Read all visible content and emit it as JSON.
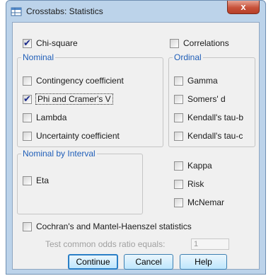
{
  "window": {
    "title": "Crosstabs: Statistics",
    "close_label": "x"
  },
  "chi_square": {
    "label": "Chi-square",
    "checked": true
  },
  "correlations": {
    "label": "Correlations",
    "checked": false
  },
  "nominal": {
    "legend": "Nominal",
    "items": [
      {
        "label": "Contingency coefficient",
        "checked": false
      },
      {
        "label": "Phi and Cramer's V",
        "checked": true
      },
      {
        "label": "Lambda",
        "checked": false
      },
      {
        "label": "Uncertainty coefficient",
        "checked": false
      }
    ]
  },
  "ordinal": {
    "legend": "Ordinal",
    "items": [
      {
        "label": "Gamma",
        "checked": false
      },
      {
        "label": "Somers' d",
        "checked": false
      },
      {
        "label": "Kendall's tau-b",
        "checked": false
      },
      {
        "label": "Kendall's tau-c",
        "checked": false
      }
    ]
  },
  "nominal_by_interval": {
    "legend": "Nominal by Interval",
    "items": [
      {
        "label": "Eta",
        "checked": false
      }
    ]
  },
  "other": [
    {
      "label": "Kappa",
      "checked": false
    },
    {
      "label": "Risk",
      "checked": false
    },
    {
      "label": "McNemar",
      "checked": false
    }
  ],
  "cmh": {
    "label": "Cochran's and Mantel-Haenszel statistics",
    "checked": false
  },
  "odds": {
    "label": "Test common odds ratio equals:",
    "value": "1"
  },
  "buttons": {
    "continue": "Continue",
    "cancel": "Cancel",
    "help": "Help"
  }
}
